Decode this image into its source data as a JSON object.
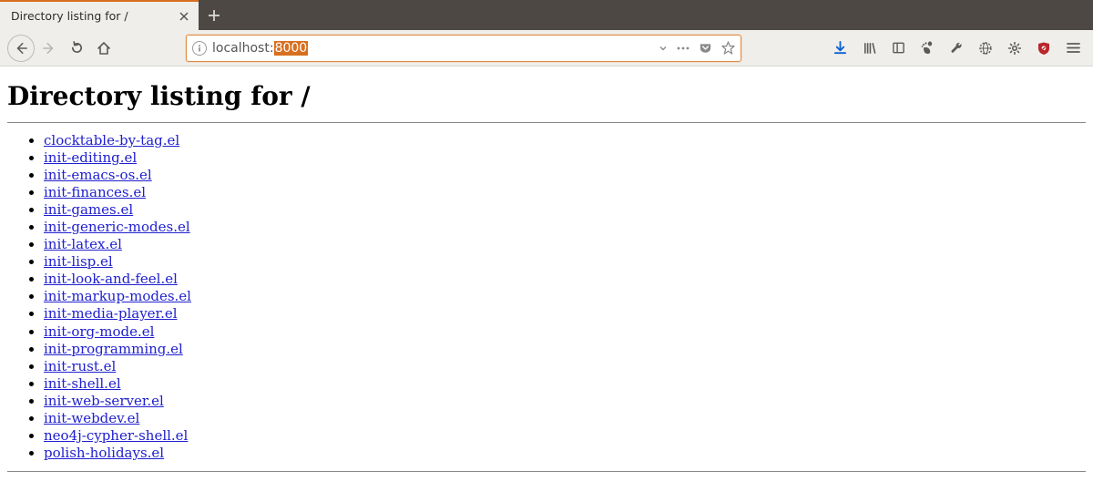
{
  "browser": {
    "tab_title": "Directory listing for /",
    "url_host": "localhost:",
    "url_port": "8000"
  },
  "page": {
    "heading": "Directory listing for /",
    "files": [
      "clocktable-by-tag.el",
      "init-editing.el",
      "init-emacs-os.el",
      "init-finances.el",
      "init-games.el",
      "init-generic-modes.el",
      "init-latex.el",
      "init-lisp.el",
      "init-look-and-feel.el",
      "init-markup-modes.el",
      "init-media-player.el",
      "init-org-mode.el",
      "init-programming.el",
      "init-rust.el",
      "init-shell.el",
      "init-web-server.el",
      "init-webdev.el",
      "neo4j-cypher-shell.el",
      "polish-holidays.el"
    ]
  }
}
